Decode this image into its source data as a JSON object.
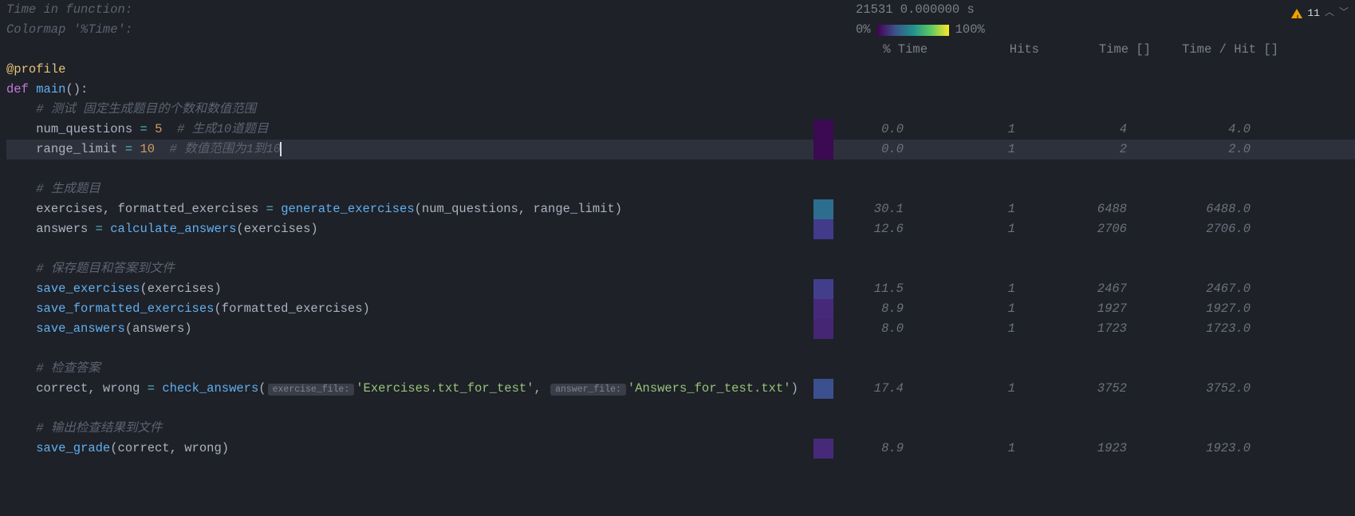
{
  "header": {
    "time_label": "Time in function:",
    "time_value": "21531 0.000000 s",
    "colormap_label": "Colormap '%Time':",
    "colormap_low": "0%",
    "colormap_high": "100%",
    "warning_count": "11"
  },
  "columns": {
    "c1": "% Time",
    "c2": "Hits",
    "c3": "Time []",
    "c4": "Time / Hit []"
  },
  "code": {
    "decorator": "@profile",
    "def_kw": "def",
    "fn_name": "main",
    "parens": "():",
    "indent1": "    ",
    "indent2": "        ",
    "comment1": "# 测试 固定生成题目的个数和数值范围",
    "line_nq1": "num_questions ",
    "eq": "=",
    "five": " 5",
    "cnq": "  # 生成10道题目",
    "line_rl1": "range_limit ",
    "ten": " 10",
    "crl": "  # 数值范围为1到10",
    "comment2": "# 生成题目",
    "gen1a": "exercises, formatted_exercises ",
    "gen1b": " generate_exercises",
    "gen1c": "(num_questions, range_limit)",
    "ans1a": "answers ",
    "ans1b": " calculate_answers",
    "ans1c": "(exercises)",
    "comment3": "# 保存题目和答案到文件",
    "se": "save_exercises",
    "se_args": "(exercises)",
    "sfe": "save_formatted_exercises",
    "sfe_args": "(formatted_exercises)",
    "sa": "save_answers",
    "sa_args": "(answers)",
    "comment4": "# 检查答案",
    "chk1a": "correct, wrong ",
    "chk1b": " check_answers",
    "chk_open": "(",
    "hint_ef": "exercise_file:",
    "chk_str1": "'Exercises.txt_for_test'",
    "chk_comma": ", ",
    "hint_af": "answer_file:",
    "chk_str2": "'Answers_for_test.txt'",
    "chk_close": ")",
    "comment5": "# 输出检查结果到文件",
    "sg": "save_grade",
    "sg_args": "(correct, wrong)"
  },
  "rows": [
    {
      "color": "#3b0a52",
      "pct": "0.0",
      "hits": "1",
      "time": "4",
      "tph": "4.0"
    },
    {
      "color": "#3b0a52",
      "pct": "0.0",
      "hits": "1",
      "time": "2",
      "tph": "2.0"
    },
    {
      "color": "#2d6e8e",
      "pct": "30.1",
      "hits": "1",
      "time": "6488",
      "tph": "6488.0"
    },
    {
      "color": "#413b8a",
      "pct": "12.6",
      "hits": "1",
      "time": "2706",
      "tph": "2706.0"
    },
    {
      "color": "#423e8c",
      "pct": "11.5",
      "hits": "1",
      "time": "2467",
      "tph": "2467.0"
    },
    {
      "color": "#462a79",
      "pct": "8.9",
      "hits": "1",
      "time": "1927",
      "tph": "1927.0"
    },
    {
      "color": "#452675",
      "pct": "8.0",
      "hits": "1",
      "time": "1723",
      "tph": "1723.0"
    },
    {
      "color": "#3c4f8e",
      "pct": "17.4",
      "hits": "1",
      "time": "3752",
      "tph": "3752.0"
    },
    {
      "color": "#462a79",
      "pct": "8.9",
      "hits": "1",
      "time": "1923",
      "tph": "1923.0"
    }
  ]
}
